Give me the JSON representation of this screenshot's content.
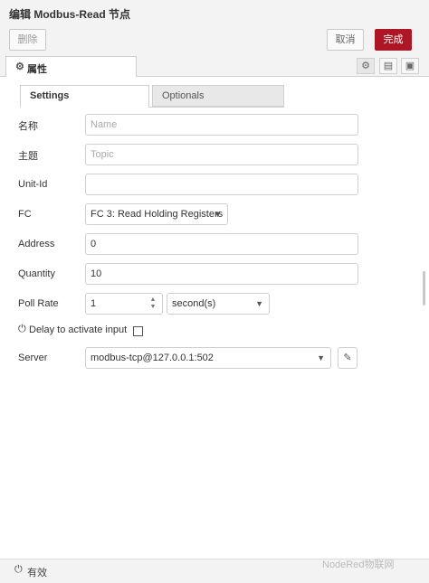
{
  "header": {
    "title": "编辑 Modbus-Read 节点"
  },
  "actions": {
    "delete": "删除",
    "cancel": "取消",
    "done": "完成"
  },
  "tabs": {
    "properties": "属性"
  },
  "subtabs": {
    "settings": "Settings",
    "optionals": "Optionals"
  },
  "form": {
    "name": {
      "label": "名称",
      "placeholder": "Name"
    },
    "topic": {
      "label": "主题",
      "placeholder": "Topic"
    },
    "unit_id": {
      "label": "Unit-Id",
      "value": ""
    },
    "fc": {
      "label": "FC",
      "value": "FC 3: Read Holding Registers"
    },
    "address": {
      "label": "Address",
      "value": "0"
    },
    "quantity": {
      "label": "Quantity",
      "value": "10"
    },
    "poll_rate": {
      "label": "Poll Rate",
      "value": "1",
      "unit": "second(s)"
    },
    "delay": {
      "label": "Delay to activate input",
      "checked": false
    },
    "server": {
      "label": "Server",
      "value": "modbus-tcp@127.0.0.1:502"
    }
  },
  "footer": {
    "enabled_label": "有效"
  },
  "watermark": "NodeRed物联网",
  "colors": {
    "accent": "#ad1625"
  }
}
